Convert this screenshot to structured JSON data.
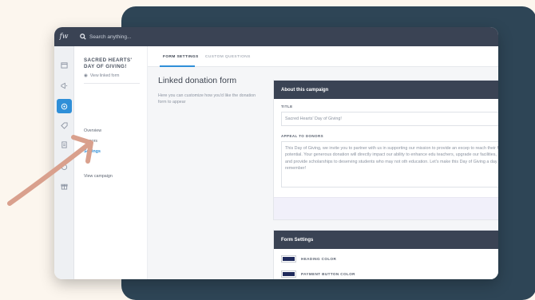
{
  "app": {
    "logo": "fw",
    "search_placeholder": "Search anything..."
  },
  "rail": {
    "icons": [
      "calendar-icon",
      "megaphone-icon",
      "target-icon",
      "tag-icon",
      "receipt-icon",
      "coin-icon",
      "gift-icon"
    ],
    "active": "target-icon"
  },
  "subnav": {
    "campaign_name": "SACRED HEARTS' DAY OF GIVING!",
    "view_linked": "View linked form",
    "items": [
      "Overview",
      "Donors",
      "Settings",
      "View campaign"
    ],
    "active_item": "Settings"
  },
  "tabs": [
    {
      "label": "FORM SETTINGS",
      "active": true
    },
    {
      "label": "CUSTOM QUESTIONS",
      "active": false
    }
  ],
  "section": {
    "title": "Linked donation form",
    "description": "Here you can customize how you'd like the donation form to appear"
  },
  "about_card": {
    "header": "About this campaign",
    "title_label": "TITLE",
    "title_value": "Sacred Hearts' Day of Giving!",
    "appeal_label": "APPEAL TO DONORS",
    "appeal_value": "This Day of Giving, we invite you to partner with us in supporting our mission to provide an excep to reach their full potential. Your generous donation will directly impact our ability to enhance edu teachers, upgrade our facilities, and provide scholarships to deserving students who may not oth education. Let's make this Day of Giving a day to remember!"
  },
  "form_settings_card": {
    "header": "Form Settings",
    "heading_color_label": "HEADING COLOR",
    "payment_button_color_label": "PAYMENT BUTTON COLOR",
    "heading_color": "#1f2a5c",
    "payment_button_color": "#1f2a5c"
  },
  "colors": {
    "topbar": "#3a4354",
    "accent": "#2f8fd8",
    "backdrop": "#2e4556",
    "arrow": "#d9a08d"
  }
}
